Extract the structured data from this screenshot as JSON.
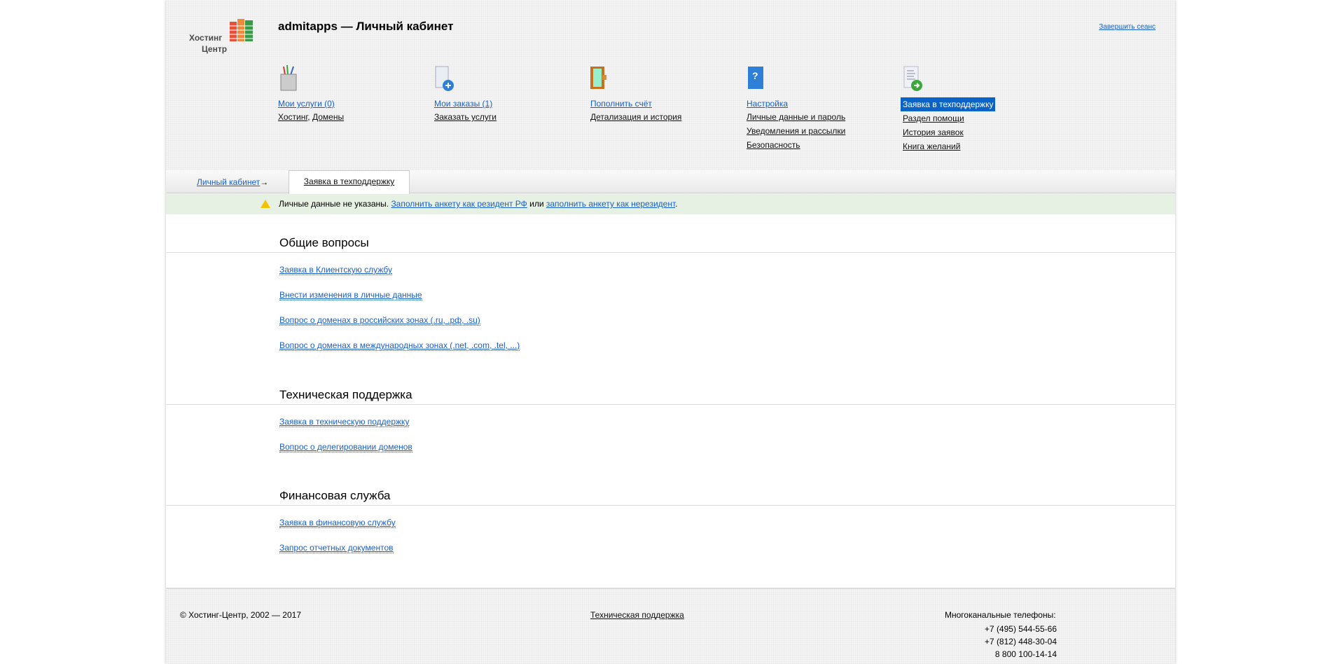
{
  "header": {
    "logo_line1": "Хостинг",
    "logo_line2": "Центр",
    "title": "admitapps — Личный кабинет",
    "logout": "Завершить сеанс"
  },
  "nav": [
    {
      "icon": "pencil-cup-icon",
      "main": "Мои услуги (0)",
      "subs": []
    },
    {
      "icon": "bag-add-icon",
      "main": "Мои заказы (1)",
      "subs": [
        "Заказать услуги"
      ]
    },
    {
      "icon": "wallet-icon",
      "main": "Пополнить счёт",
      "subs": [
        "Детализация и история"
      ]
    },
    {
      "icon": "help-book-icon",
      "main": "Настройка",
      "subs": [
        "Личные данные и пароль",
        "Уведомления и рассылки",
        "Безопасность"
      ]
    },
    {
      "icon": "document-arrow-icon",
      "main": "Заявка в техподдержку",
      "subs": [
        "Раздел помощи",
        "История заявок",
        "Книга желаний"
      ]
    }
  ],
  "nav_services_sub": {
    "a": "Хостинг",
    "sep": ", ",
    "b": "Домены"
  },
  "breadcrumb": {
    "home": "Личный кабинет",
    "arrow": "→",
    "current": "Заявка в техподдержку"
  },
  "notice": {
    "text": "Личные данные не указаны. ",
    "link1": "Заполнить анкету как резидент РФ",
    "or": " или ",
    "link2": "заполнить анкету как нерезидент",
    "end": "."
  },
  "sections": [
    {
      "title": "Общие вопросы",
      "links": [
        "Заявка в Клиентскую службу",
        "Внести изменения в личные данные",
        "Вопрос о доменах в российских зонах (.ru, .рф, .su)",
        "Вопрос о доменах в международных зонах (.net, .com, .tel, ...)"
      ]
    },
    {
      "title": "Техническая поддержка",
      "links": [
        "Заявка в техническую поддержку",
        "Вопрос о делегировании доменов"
      ]
    },
    {
      "title": "Финансовая служба",
      "links": [
        "Заявка в финансовую службу",
        "Запрос отчетных документов"
      ]
    }
  ],
  "footer": {
    "copyright": "© Хостинг-Центр, 2002 — 2017",
    "support": "Техническая поддержка",
    "phones_label": "Многоканальные телефоны:",
    "phones": [
      "+7 (495) 544-55-66",
      "+7 (812) 448-30-04",
      "8 800 100-14-14"
    ]
  }
}
